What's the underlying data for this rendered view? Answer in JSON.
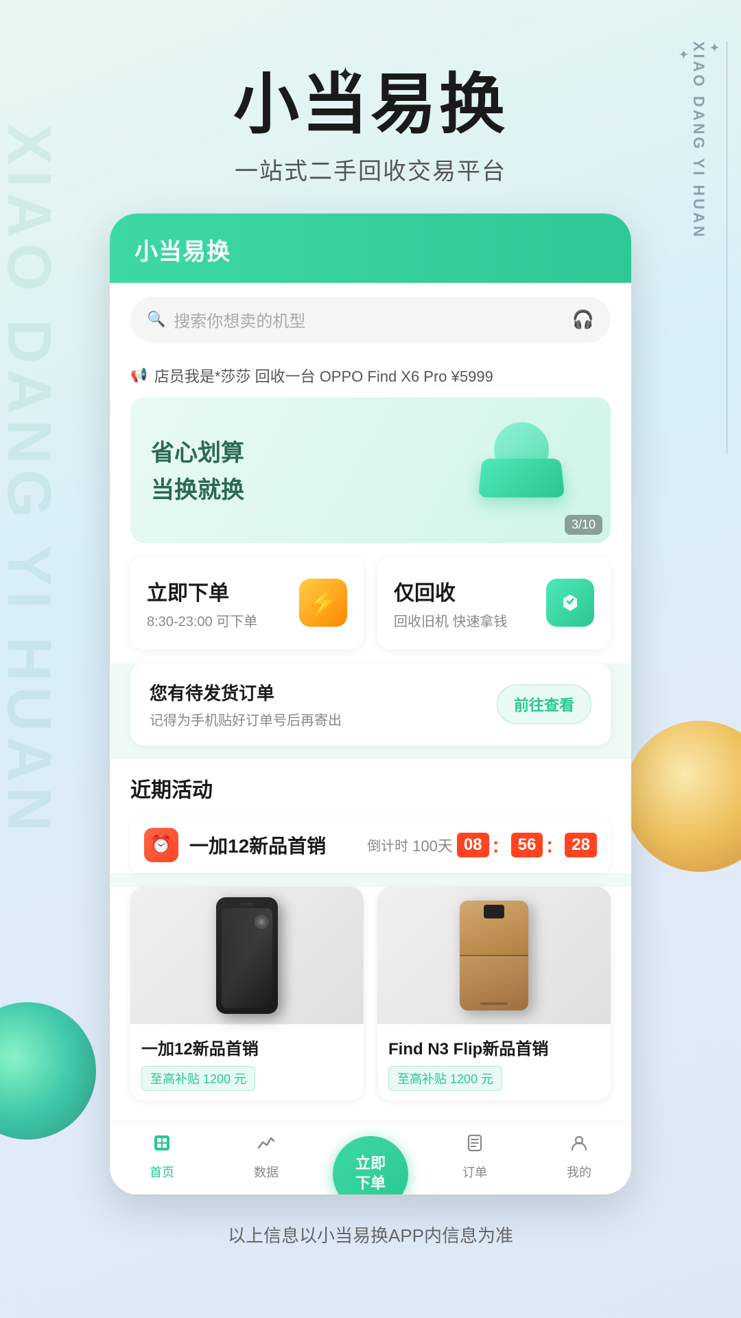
{
  "app": {
    "title": "小当易换",
    "subtitle": "一站式二手回收交易平台",
    "logo": "小当易换"
  },
  "background": {
    "left_text": "XIAO DANG YI HUAN",
    "right_text": "XIAO DANG YI HUAN"
  },
  "sparkles": {
    "symbol": "✦"
  },
  "search": {
    "placeholder": "搜索你想卖的机型",
    "icon": "🔍",
    "headphone_icon": "🎧"
  },
  "announcement": {
    "icon": "📢",
    "text": "店员我是*莎莎 回收一台 OPPO Find X6 Pro ¥5999"
  },
  "banner": {
    "line1": "省心划算",
    "line2": "当换就换",
    "badge": "3/10"
  },
  "quick_actions": [
    {
      "title": "立即下单",
      "subtitle": "8:30-23:00 可下单",
      "icon": "⚡"
    },
    {
      "title": "仅回收",
      "subtitle": "回收旧机 快速拿钱",
      "icon": "🔄"
    }
  ],
  "order_reminder": {
    "title": "您有待发货订单",
    "subtitle": "记得为手机贴好订单号后再寄出",
    "button": "前往查看"
  },
  "recent_activity": {
    "section_title": "近期活动",
    "activity_name": "一加12新品首销",
    "activity_icon": "⏰",
    "countdown": {
      "label": "倒计时",
      "days": "100天",
      "hours": "08",
      "minutes": "56",
      "seconds": "28"
    }
  },
  "products": [
    {
      "name": "一加12新品首销",
      "subsidy": "至高补贴 1200 元"
    },
    {
      "name": "Find N3 Flip新品首销",
      "subsidy": "至高补贴 1200 元"
    }
  ],
  "bottom_nav": [
    {
      "label": "首页",
      "icon": "⊟",
      "active": true
    },
    {
      "label": "数据",
      "icon": "📈",
      "active": false
    },
    {
      "label": "立即\n下单",
      "icon": "",
      "is_fab": true
    },
    {
      "label": "订单",
      "icon": "☐",
      "active": false
    },
    {
      "label": "我的",
      "icon": "👤",
      "active": false
    }
  ],
  "footer": {
    "text": "以上信息以小当易换APP内信息为准"
  }
}
